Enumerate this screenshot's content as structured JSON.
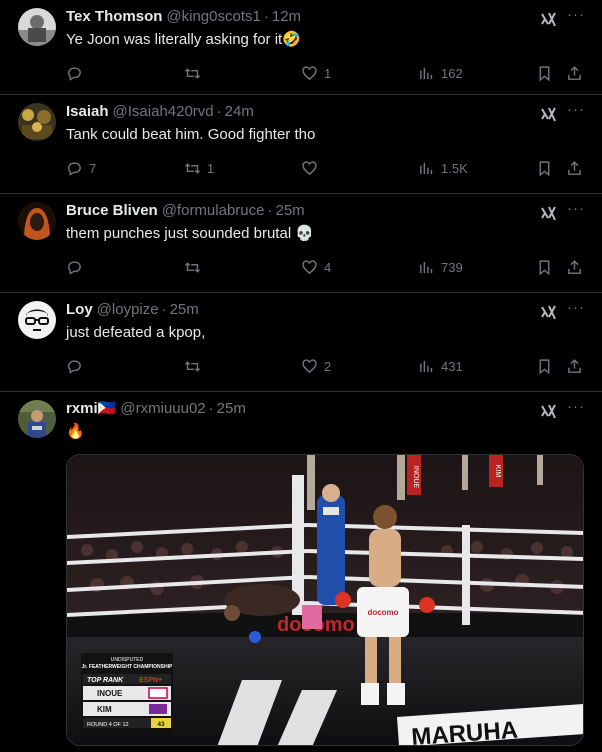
{
  "tweets": [
    {
      "name": "Tex Thomson",
      "handle": "@king0scots1",
      "time": "12m",
      "text": "Ye Joon was literally asking for it🤣",
      "replies": "",
      "retweets": "",
      "likes": "1",
      "views": "162"
    },
    {
      "name": "Isaiah",
      "handle": "@Isaiah420rvd",
      "time": "24m",
      "text": "Tank could beat him. Good fighter tho",
      "replies": "7",
      "retweets": "1",
      "likes": "",
      "views": "1.5K"
    },
    {
      "name": "Bruce Bliven",
      "handle": "@formulabruce",
      "time": "25m",
      "text": "them punches just sounded brutal 💀",
      "replies": "",
      "retweets": "",
      "likes": "4",
      "views": "739"
    },
    {
      "name": "Loy",
      "handle": "@loypize",
      "time": "25m",
      "text": "just defeated a kpop,",
      "replies": "",
      "retweets": "",
      "likes": "2",
      "views": "431"
    },
    {
      "name": "rxmi🇵🇭",
      "handle": "@rxmiuuu02",
      "time": "25m",
      "text": "🔥"
    }
  ],
  "more_label": "···",
  "separator": "·",
  "media": {
    "scorebug": {
      "undisputed": "UNDISPUTED",
      "championship": "Jr. FEATHERWEIGHT CHAMPIONSHIP",
      "promoter": "TOP RANK",
      "network": "ESPN+",
      "fighter1": "INOUE",
      "fighter2": "KIM",
      "round": "ROUND 4 OF 12",
      "clock": "43"
    },
    "sponsor": "docomo",
    "trunks_text": "docomo",
    "canvas_text": "MARUHA",
    "post_text_1": "INOUE",
    "post_text_2": "KIM"
  },
  "colors": {
    "bg": "#000000",
    "border": "#2f3336",
    "text": "#e7e9ea",
    "muted": "#71767b"
  }
}
